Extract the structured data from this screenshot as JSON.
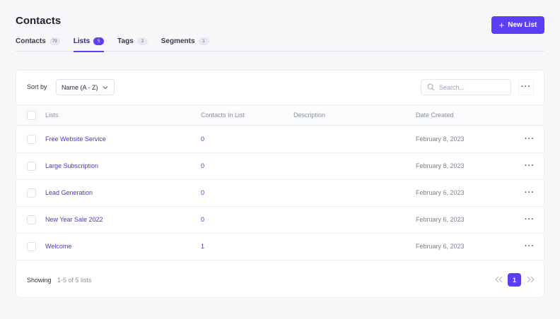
{
  "header": {
    "title": "Contacts",
    "new_list_label": "New List"
  },
  "tabs": [
    {
      "label": "Contacts",
      "count": "79"
    },
    {
      "label": "Lists",
      "count": "5"
    },
    {
      "label": "Tags",
      "count": "3"
    },
    {
      "label": "Segments",
      "count": "1"
    }
  ],
  "toolbar": {
    "sort_label": "Sort by",
    "sort_value": "Name (A - Z)",
    "search_placeholder": "Search..."
  },
  "table": {
    "columns": [
      "Lists",
      "Contacts In List",
      "Description",
      "Date Created"
    ],
    "rows": [
      {
        "name": "Free Website Service",
        "contacts": "0",
        "description": "",
        "date": "February 8, 2023"
      },
      {
        "name": "Large Subscription",
        "contacts": "0",
        "description": "",
        "date": "February 8, 2023"
      },
      {
        "name": "Lead Generation",
        "contacts": "0",
        "description": "",
        "date": "February 6, 2023"
      },
      {
        "name": "New Year Sale 2022",
        "contacts": "0",
        "description": "",
        "date": "February 6, 2023"
      },
      {
        "name": "Welcome",
        "contacts": "1",
        "description": "",
        "date": "February 6, 2023"
      }
    ]
  },
  "footer": {
    "showing_label": "Showing",
    "range": "1-5 of 5 lists",
    "current_page": "1"
  },
  "colors": {
    "accent": "#5b3ff5",
    "link": "#4a35d6",
    "background": "#f7f7fa"
  },
  "icons": [
    "plus-icon",
    "chevron-down-icon",
    "search-icon",
    "more-icon",
    "double-chevron-left-icon",
    "double-chevron-right-icon"
  ]
}
